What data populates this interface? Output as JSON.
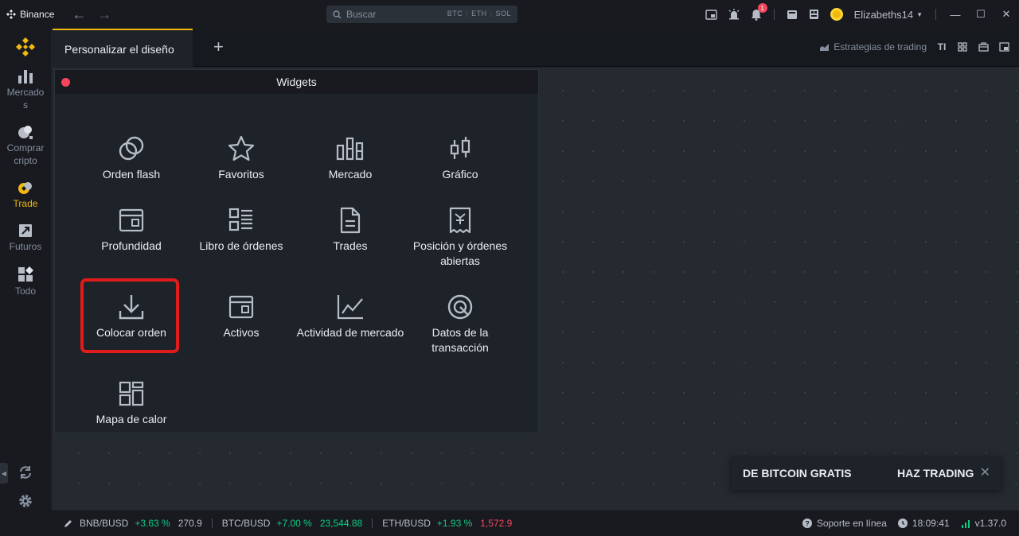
{
  "titlebar": {
    "app_name": "Binance",
    "search_placeholder": "Buscar",
    "search_chips": [
      "BTC",
      "ETH",
      "SOL"
    ],
    "notification_count": "1",
    "username": "Elizabeths14"
  },
  "sidebar": {
    "items": [
      {
        "label": "Mercado\ns",
        "icon": "bar-chart-icon"
      },
      {
        "label": "Comprar\ncripto",
        "icon": "coins-icon"
      },
      {
        "label": "Trade",
        "icon": "trade-icon"
      },
      {
        "label": "Futuros",
        "icon": "futures-icon"
      },
      {
        "label": "Todo",
        "icon": "grid-icon"
      }
    ]
  },
  "tabbar": {
    "active_tab": "Personalizar el diseño",
    "strategies_label": "Estrategias de trading",
    "ti_label": "TI"
  },
  "widgets_panel": {
    "title": "Widgets",
    "items": [
      {
        "label": "Orden flash",
        "icon": "flash-order-icon"
      },
      {
        "label": "Favoritos",
        "icon": "star-icon"
      },
      {
        "label": "Mercado",
        "icon": "market-icon"
      },
      {
        "label": "Gráfico",
        "icon": "candlestick-icon"
      },
      {
        "label": "Profundidad",
        "icon": "depth-icon"
      },
      {
        "label": "Libro de órdenes",
        "icon": "order-book-icon"
      },
      {
        "label": "Trades",
        "icon": "document-icon"
      },
      {
        "label": "Posición y órdenes abiertas",
        "icon": "receipt-icon"
      },
      {
        "label": "Colocar orden",
        "icon": "download-icon"
      },
      {
        "label": "Activos",
        "icon": "wallet-icon"
      },
      {
        "label": "Actividad de mercado",
        "icon": "line-chart-icon"
      },
      {
        "label": "Datos de la transacción",
        "icon": "target-icon"
      },
      {
        "label": "Mapa de calor",
        "icon": "heatmap-icon"
      }
    ]
  },
  "promo": {
    "left_text": "DE BITCOIN GRATIS",
    "right_text": "HAZ TRADING",
    "close": "✕"
  },
  "statusbar": {
    "tickers": [
      {
        "pair": "BNB/BUSD",
        "change": "+3.63 %",
        "price": "270.9",
        "direction": "neutral"
      },
      {
        "pair": "BTC/BUSD",
        "change": "+7.00 %",
        "price": "23,544.88",
        "direction": "up"
      },
      {
        "pair": "ETH/BUSD",
        "change": "+1.93 %",
        "price": "1,572.9",
        "direction": "down"
      }
    ],
    "support_label": "Soporte en línea",
    "time": "18:09:41",
    "version": "v1.37.0"
  },
  "colors": {
    "accent": "#f0b90b",
    "up": "#0ecb81",
    "down": "#f6465d",
    "highlight": "#e01b1b"
  }
}
